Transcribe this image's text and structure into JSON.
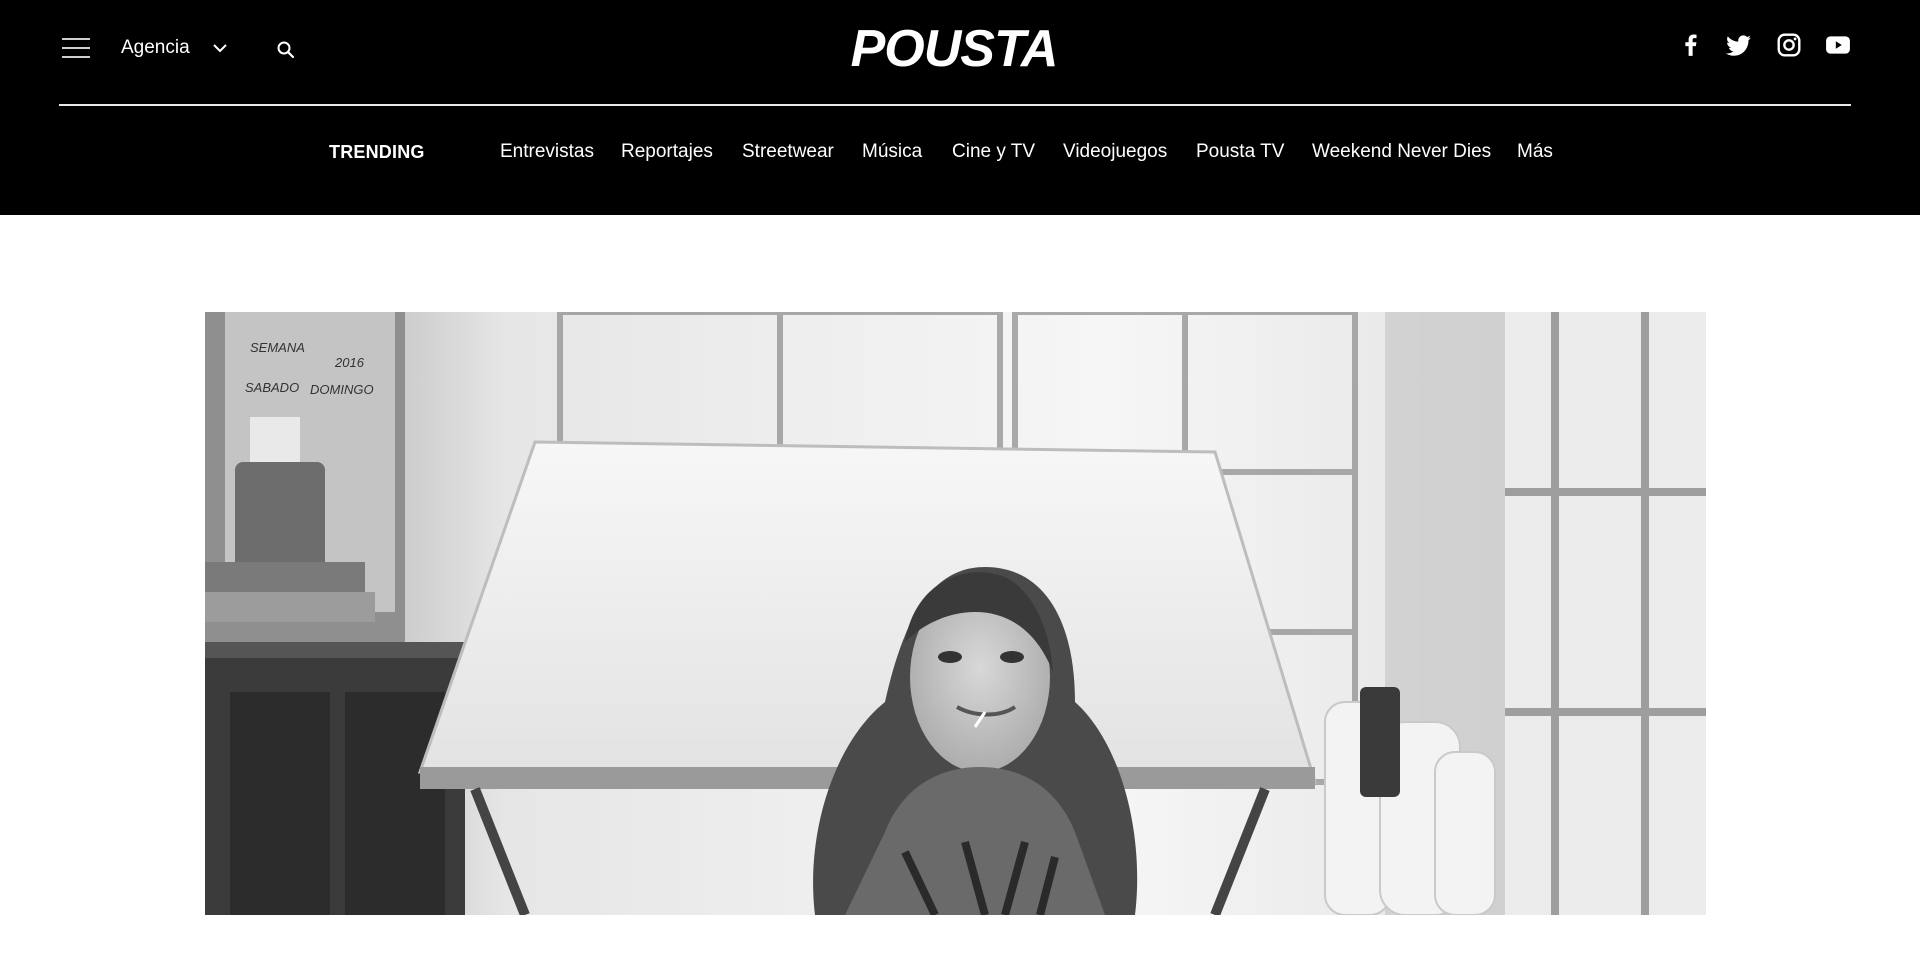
{
  "header": {
    "menu_icon": "hamburger-icon",
    "agency_label": "Agencia",
    "search_icon": "search-icon",
    "logo_text": "POUSTA",
    "social": [
      "facebook-icon",
      "twitter-icon",
      "instagram-icon",
      "youtube-icon"
    ]
  },
  "nav": {
    "trending_label": "TRENDING",
    "items": [
      {
        "label": "Entrevistas"
      },
      {
        "label": "Reportajes"
      },
      {
        "label": "Streetwear"
      },
      {
        "label": "Música"
      },
      {
        "label": "Cine y TV"
      },
      {
        "label": "Videojuegos"
      },
      {
        "label": "Pousta TV"
      },
      {
        "label": "Weekend Never Dies"
      },
      {
        "label": "Más"
      }
    ]
  },
  "hero": {
    "photo_notes": [
      "SEMANA",
      "2016",
      "SABADO",
      "DOMINGO"
    ]
  },
  "colors": {
    "header_bg": "#000000",
    "page_bg": "#ffffff",
    "text": "#ffffff"
  }
}
